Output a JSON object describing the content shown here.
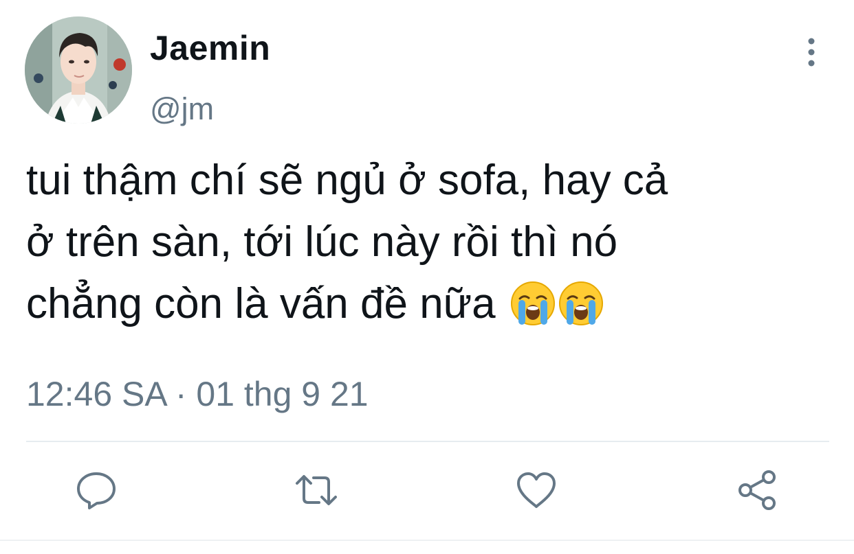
{
  "author": {
    "display_name": "Jaemin",
    "handle": "@jm"
  },
  "tweet": {
    "lines": [
      "tui thậm chí sẽ ngủ ở sofa, hay cả",
      "ở trên sàn, tới lúc này rồi thì nó",
      "chẳng còn là vấn đề nữa"
    ],
    "emojis": [
      "loudly-crying-face",
      "loudly-crying-face"
    ],
    "timestamp": "12:46 SA · 01 thg 9 21"
  },
  "actions": {
    "icons": [
      "reply-icon",
      "retweet-icon",
      "like-icon",
      "share-icon"
    ]
  },
  "colors": {
    "text": "#0f1419",
    "secondary": "#657786",
    "icon": "#657786",
    "divider": "#e6ecf0"
  }
}
